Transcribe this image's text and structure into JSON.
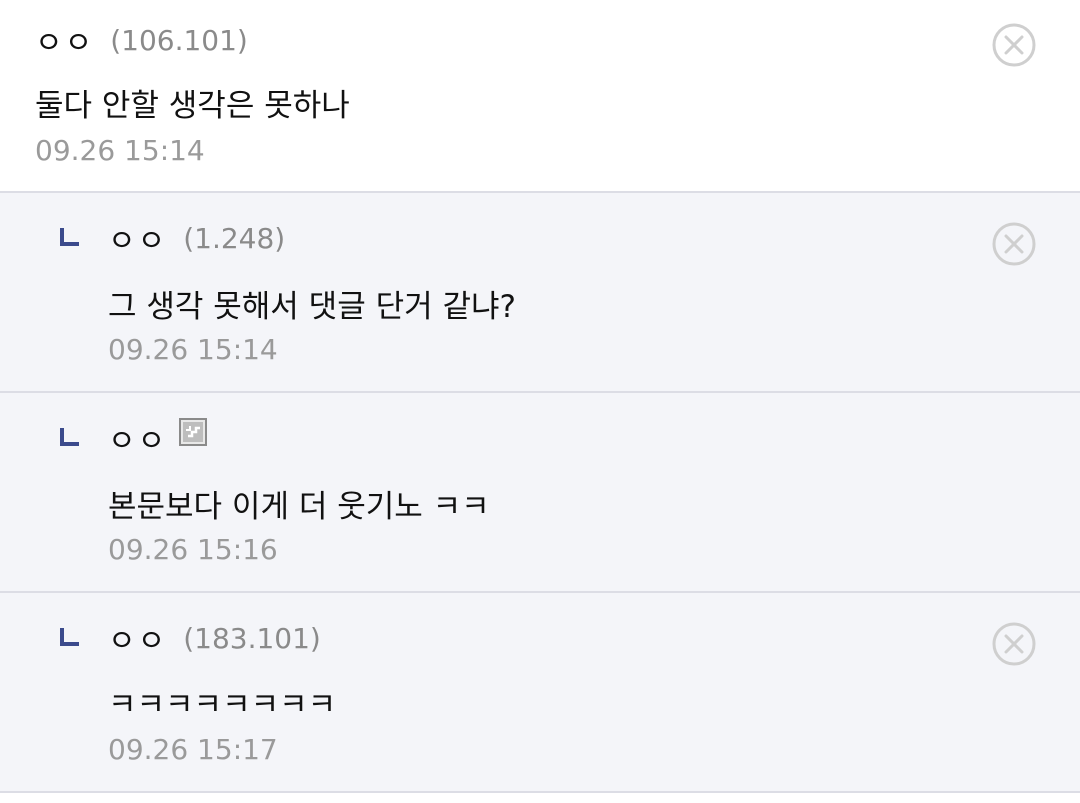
{
  "comments": [
    {
      "nickname": "ㅇㅇ",
      "ip": "(106.101)",
      "text": "둘다 안할 생각은 못하나",
      "time": "09.26 15:14",
      "deletable": true
    },
    {
      "nickname": "ㅇㅇ",
      "ip": "(1.248)",
      "text": "그 생각 못해서 댓글 단거 같냐?",
      "time": "09.26 15:14",
      "deletable": true
    },
    {
      "nickname": "ㅇㅇ",
      "ip": "",
      "text": "본문보다 이게 더 웃기노 ㅋㅋ",
      "time": "09.26 15:16",
      "deletable": false,
      "icon": "fixed-nick-gallog-icon"
    },
    {
      "nickname": "ㅇㅇ",
      "ip": "(183.101)",
      "text": "ㅋㅋㅋㅋㅋㅋㅋㅋ",
      "time": "09.26 15:17",
      "deletable": true
    }
  ],
  "colors": {
    "reply_background": "#f4f5f9",
    "reply_arrow": "#3b4a8c",
    "divider": "#dcdde5",
    "meta_text": "#9a9a9a"
  },
  "icons": {
    "reply": "reply-arrow-icon",
    "delete": "delete-circle-x-icon"
  }
}
